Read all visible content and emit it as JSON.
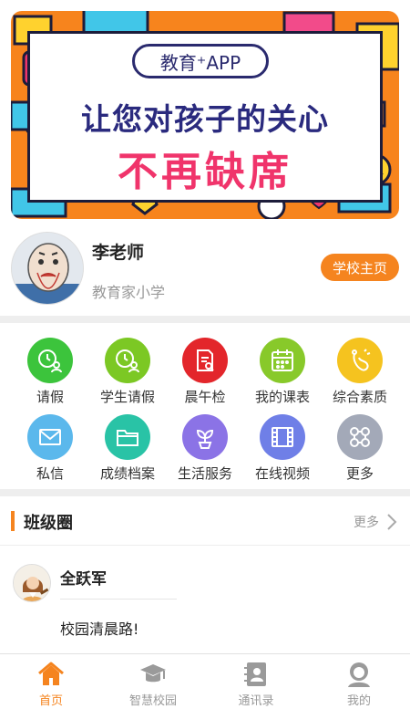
{
  "banner": {
    "pill_text": "教育⁺APP",
    "line1": "让您对孩子的关心",
    "line2": "不再缺席"
  },
  "profile": {
    "name": "李老师",
    "school": "教育家小学",
    "school_button": "学校主页"
  },
  "grid": {
    "items": [
      {
        "label": "请假",
        "icon": "leave-clock-icon",
        "color": "#3cc43c"
      },
      {
        "label": "学生请假",
        "icon": "student-leave-icon",
        "color": "#7cc824"
      },
      {
        "label": "晨午检",
        "icon": "health-check-icon",
        "color": "#e3262b"
      },
      {
        "label": "我的课表",
        "icon": "calendar-icon",
        "color": "#88c92a"
      },
      {
        "label": "综合素质",
        "icon": "quality-icon",
        "color": "#f5c31f"
      },
      {
        "label": "私信",
        "icon": "mail-icon",
        "color": "#5bb8ec"
      },
      {
        "label": "成绩档案",
        "icon": "folder-icon",
        "color": "#29c3a6"
      },
      {
        "label": "生活服务",
        "icon": "plant-icon",
        "color": "#8b73e6"
      },
      {
        "label": "在线视频",
        "icon": "film-icon",
        "color": "#6f7fe7"
      },
      {
        "label": "更多",
        "icon": "more-apps-icon",
        "color": "#a3a9b8"
      }
    ]
  },
  "class_circle": {
    "title": "班级圈",
    "more": "更多"
  },
  "post": {
    "author": "全跃军",
    "text": "校园清晨路!"
  },
  "tabbar": {
    "tabs": [
      {
        "label": "首页",
        "icon": "home-icon"
      },
      {
        "label": "智慧校园",
        "icon": "campus-icon"
      },
      {
        "label": "通讯录",
        "icon": "contacts-icon"
      },
      {
        "label": "我的",
        "icon": "profile-icon"
      }
    ]
  },
  "colors": {
    "accent": "#f5841f",
    "banner_orange": "#f7841d",
    "banner_pink": "#f0346b",
    "banner_navy": "#2a2a7e"
  }
}
